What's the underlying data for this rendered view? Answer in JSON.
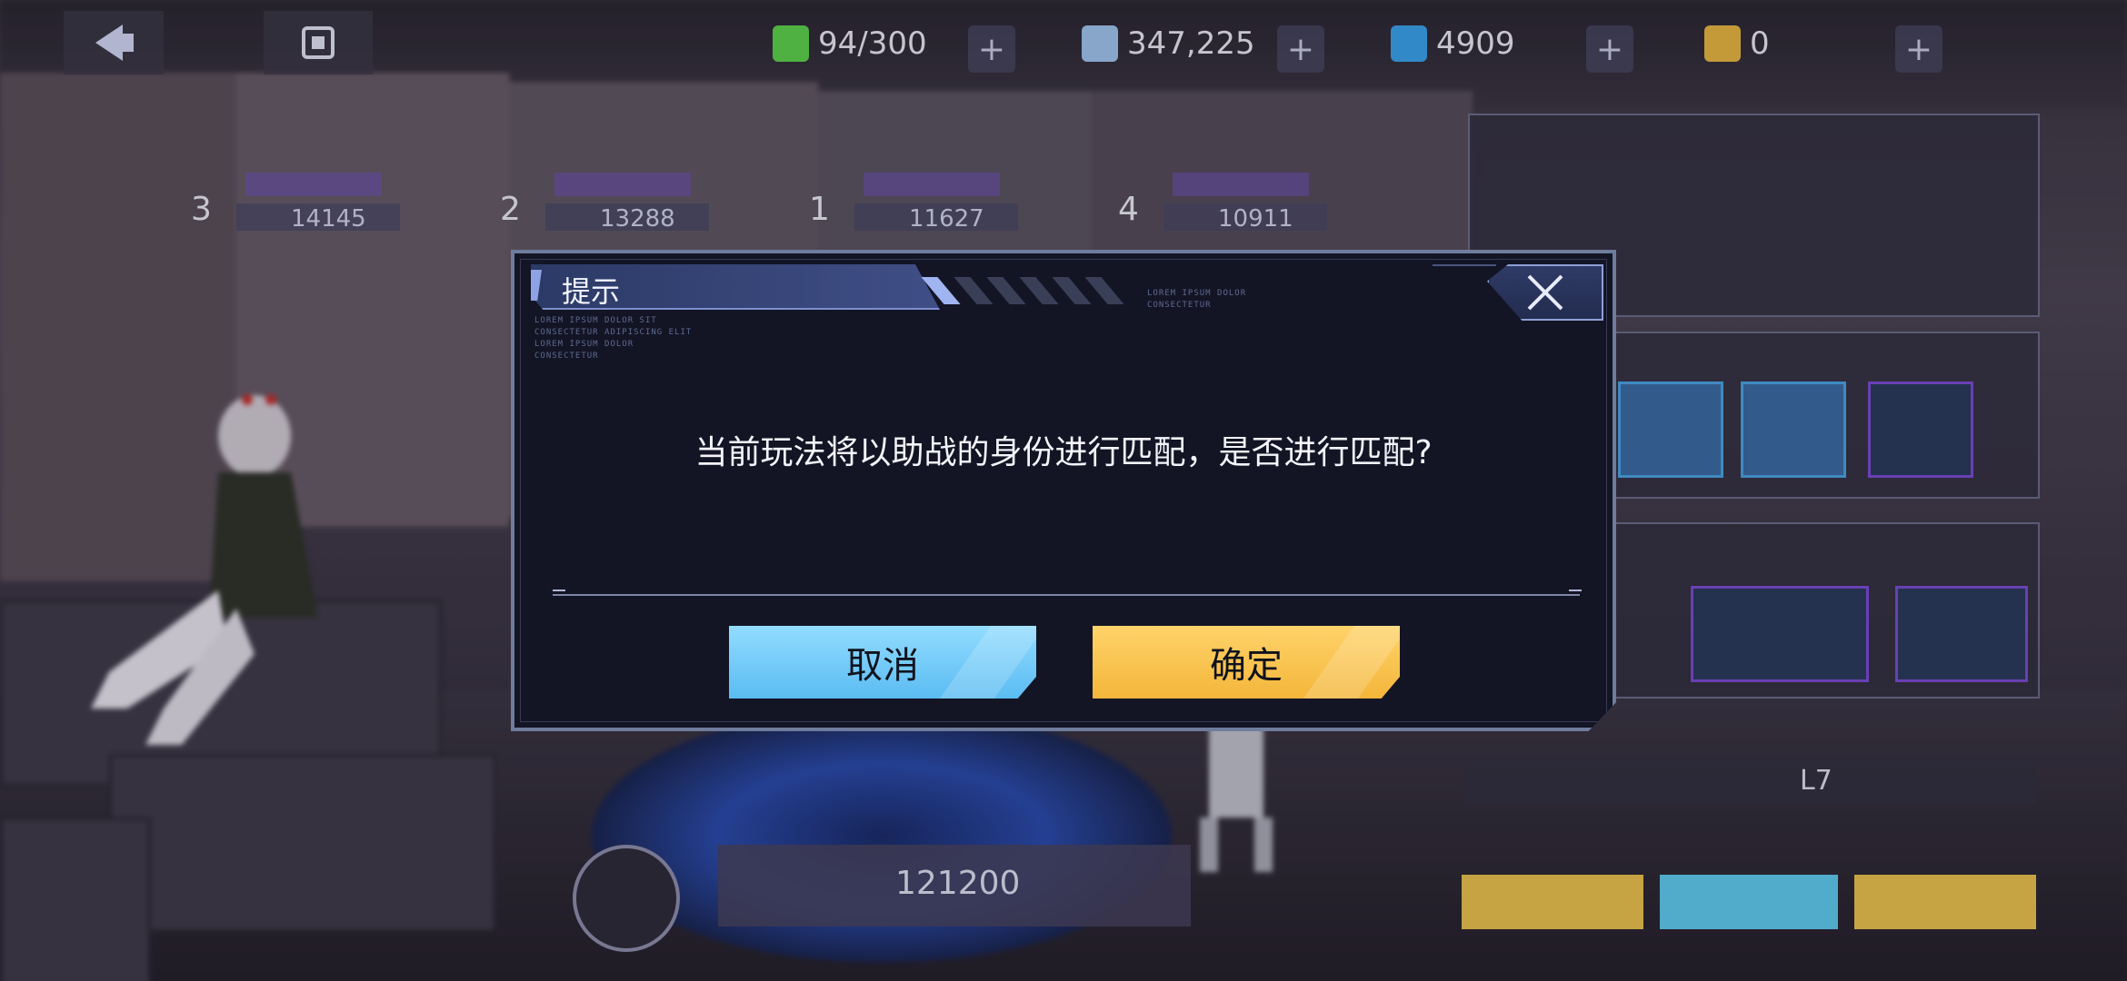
{
  "top_bar": {
    "stamina": "94/300",
    "diamonds": "347,225",
    "crystals": "4909",
    "tickets": "0",
    "plus": "+"
  },
  "team_slots": [
    {
      "num": "3",
      "power": "14145"
    },
    {
      "num": "2",
      "power": "13288"
    },
    {
      "num": "1",
      "power": "11627"
    },
    {
      "num": "4",
      "power": "10911"
    }
  ],
  "right_panel": {
    "level_text": "L7",
    "power_value": "121200"
  },
  "dialog": {
    "title": "提示",
    "lorem_left": [
      "LOREM IPSUM DOLOR SIT",
      "CONSECTETUR ADIPISCING ELIT",
      "LOREM IPSUM DOLOR",
      "CONSECTETUR"
    ],
    "lorem_right": [
      "LOREM IPSUM DOLOR",
      "CONSECTETUR"
    ],
    "message": "当前玩法将以助战的身份进行匹配，是否进行匹配?",
    "cancel_label": "取消",
    "confirm_label": "确定"
  },
  "colors": {
    "dialog_bg": "#131525",
    "cancel_btn": "#5bbcf2",
    "confirm_btn": "#f3b63a",
    "title_tab": "#3f4e86"
  },
  "icons": {
    "close": "close-icon",
    "back": "back-arrow-icon",
    "home": "home-icon"
  }
}
